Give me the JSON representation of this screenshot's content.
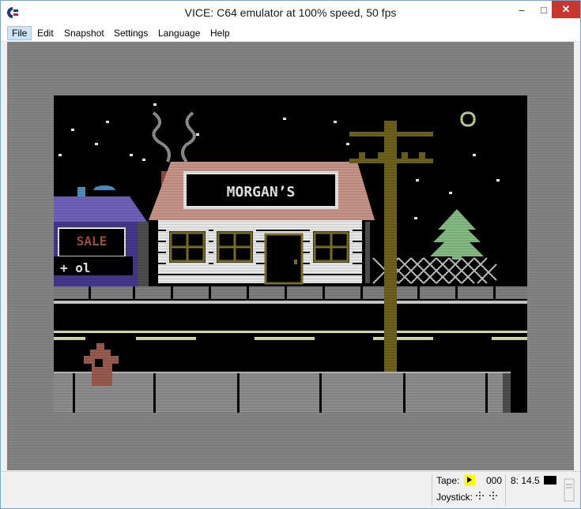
{
  "window": {
    "title": "VICE: C64 emulator at 100% speed, 50 fps",
    "app_icon": "commodore-logo-icon",
    "controls": {
      "minimize": "–",
      "maximize": "□",
      "close": "✕"
    }
  },
  "menu": {
    "items": [
      {
        "label": "File",
        "active": true
      },
      {
        "label": "Edit"
      },
      {
        "label": "Snapshot"
      },
      {
        "label": "Settings"
      },
      {
        "label": "Language"
      },
      {
        "label": "Help"
      }
    ]
  },
  "screen": {
    "scene": "night street with storefront",
    "store_sign": "MORGAN’S",
    "shop_sign": "SALE",
    "shop_sign_lower": "+ ol"
  },
  "statusbar": {
    "tape_label": "Tape:",
    "tape_counter": "000",
    "drive_label": "8: 14.5",
    "joystick_label": "Joystick:"
  },
  "colors": {
    "close_button": "#c7372f",
    "menu_highlight": "#cce4f7",
    "border_grey": "#808080",
    "tape_indicator": "#ffff00"
  }
}
